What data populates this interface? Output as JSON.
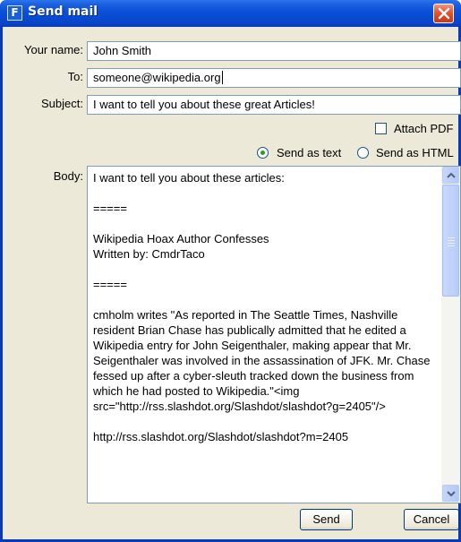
{
  "window": {
    "title": "Send mail",
    "icon_letter": "F"
  },
  "form": {
    "name_label": "Your name:",
    "name_value": "John Smith",
    "to_label": "To:",
    "to_value": "someone@wikipedia.org",
    "subject_label": "Subject:",
    "subject_value": "I want to tell you about these great Articles!",
    "attach_pdf_label": "Attach PDF",
    "attach_pdf_checked": false,
    "send_as_text_label": "Send as text",
    "send_as_html_label": "Send as HTML",
    "selected_format": "text",
    "body_label": "Body:",
    "body_value": "I want to tell you about these articles:\n\n=====\n\nWikipedia Hoax Author Confesses\nWritten by: CmdrTaco\n\n=====\n\ncmholm writes \"As reported in The Seattle Times, Nashville resident Brian Chase has publically admitted that he edited a Wikipedia entry for John Seigenthaler, making appear that Mr. Seigenthaler was involved in the assassination of JFK. Mr. Chase fessed up after a cyber-sleuth tracked down the business from which he had posted to Wikipedia.\"<img src=\"http://rss.slashdot.org/Slashdot/slashdot?g=2405\"/>\n\nhttp://rss.slashdot.org/Slashdot/slashdot?m=2405"
  },
  "buttons": {
    "send": "Send",
    "cancel": "Cancel"
  },
  "icons": {
    "app": "app-logo-icon",
    "close": "close-icon",
    "scroll_up": "scroll-up-arrow-icon",
    "scroll_down": "scroll-down-arrow-icon"
  },
  "colors": {
    "titlebar": "#0b4fd9",
    "close": "#e0502c",
    "window_bg": "#ece9d8",
    "radio_dot": "#21a121"
  }
}
